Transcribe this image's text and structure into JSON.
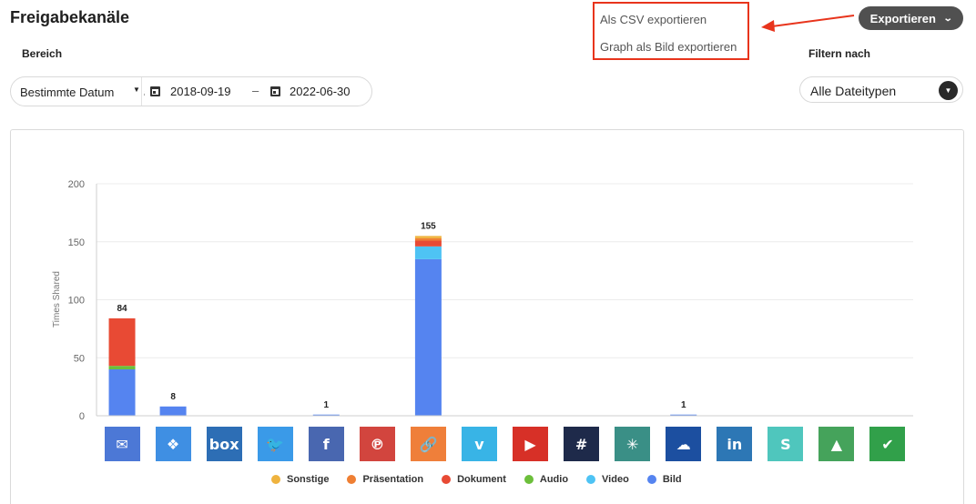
{
  "page": {
    "title": "Freigabekanäle"
  },
  "export_menu": {
    "items": [
      "Als CSV exportieren",
      "Graph als Bild exportieren"
    ],
    "button_label": "Exportieren",
    "highlight_color": "#e8341c"
  },
  "range": {
    "label": "Bereich",
    "select_value": "Bestimmte Datum",
    "select_overflow": "a",
    "start_date": "2018-09-19",
    "separator": "–",
    "end_date": "2022-06-30"
  },
  "filter": {
    "label": "Filtern nach",
    "value": "Alle Dateitypen"
  },
  "chart_data": {
    "type": "bar",
    "stacked": true,
    "ylabel": "Times Shared",
    "ylim": [
      0,
      200
    ],
    "yticks": [
      0,
      50,
      100,
      150,
      200
    ],
    "grid": true,
    "legend_position": "bottom",
    "categories": [
      "E-Mail",
      "Dropbox",
      "Box",
      "Twitter",
      "Facebook",
      "Pinterest",
      "Link",
      "Vimeo",
      "YouTube",
      "Slack",
      "Yammer",
      "OneDrive",
      "LinkedIn",
      "SharePoint",
      "Google Drive",
      "Highspot"
    ],
    "series": [
      {
        "name": "Bild",
        "color": "#5584f0",
        "values": [
          40,
          8,
          0,
          0,
          1,
          0,
          135,
          0,
          0,
          0,
          0,
          1,
          0,
          0,
          0,
          0
        ]
      },
      {
        "name": "Video",
        "color": "#4ec3f4",
        "values": [
          0,
          0,
          0,
          0,
          0,
          0,
          11,
          0,
          0,
          0,
          0,
          0,
          0,
          0,
          0,
          0
        ]
      },
      {
        "name": "Audio",
        "color": "#6cbf3b",
        "values": [
          3,
          0,
          0,
          0,
          0,
          0,
          0,
          0,
          0,
          0,
          0,
          0,
          0,
          0,
          0,
          0
        ]
      },
      {
        "name": "Dokument",
        "color": "#e84a34",
        "values": [
          41,
          0,
          0,
          0,
          0,
          0,
          5,
          0,
          0,
          0,
          0,
          0,
          0,
          0,
          0,
          0
        ]
      },
      {
        "name": "Präsentation",
        "color": "#ef7f33",
        "values": [
          0,
          0,
          0,
          0,
          0,
          0,
          2,
          0,
          0,
          0,
          0,
          0,
          0,
          0,
          0,
          0
        ]
      },
      {
        "name": "Sonstige",
        "color": "#efb33f",
        "values": [
          0,
          0,
          0,
          0,
          0,
          0,
          2,
          0,
          0,
          0,
          0,
          0,
          0,
          0,
          0,
          0
        ]
      }
    ],
    "legend_order": [
      "Sonstige",
      "Präsentation",
      "Dokument",
      "Audio",
      "Video",
      "Bild"
    ],
    "total_labels": [
      "84",
      "8",
      "",
      "",
      "1",
      "",
      "155",
      "",
      "",
      "",
      "",
      "1",
      "",
      "",
      "",
      ""
    ]
  },
  "icons": [
    {
      "name": "email-icon",
      "bg": "#4c78d6",
      "glyph": "✉"
    },
    {
      "name": "dropbox-icon",
      "bg": "#3f8fe3",
      "glyph": "❖"
    },
    {
      "name": "box-icon",
      "bg": "#2d6eb5",
      "glyph": "box"
    },
    {
      "name": "twitter-icon",
      "bg": "#3a9ae8",
      "glyph": "🐦"
    },
    {
      "name": "facebook-icon",
      "bg": "#4967b0",
      "glyph": "f"
    },
    {
      "name": "pinterest-icon",
      "bg": "#d2453e",
      "glyph": "℗"
    },
    {
      "name": "link-icon",
      "bg": "#ef7f3a",
      "glyph": "🔗"
    },
    {
      "name": "vimeo-icon",
      "bg": "#38b4e6",
      "glyph": "v"
    },
    {
      "name": "youtube-icon",
      "bg": "#d73027",
      "glyph": "▶"
    },
    {
      "name": "slack-icon",
      "bg": "#1e2a4a",
      "glyph": "#"
    },
    {
      "name": "yammer-icon",
      "bg": "#3a8f86",
      "glyph": "✳"
    },
    {
      "name": "onedrive-icon",
      "bg": "#1c4fa0",
      "glyph": "☁"
    },
    {
      "name": "linkedin-icon",
      "bg": "#2d77b5",
      "glyph": "in"
    },
    {
      "name": "sharepoint-icon",
      "bg": "#4fc6bd",
      "glyph": "S"
    },
    {
      "name": "google-drive-icon",
      "bg": "#45a35b",
      "glyph": "▲"
    },
    {
      "name": "highspot-icon",
      "bg": "#31a04a",
      "glyph": "✔"
    }
  ]
}
